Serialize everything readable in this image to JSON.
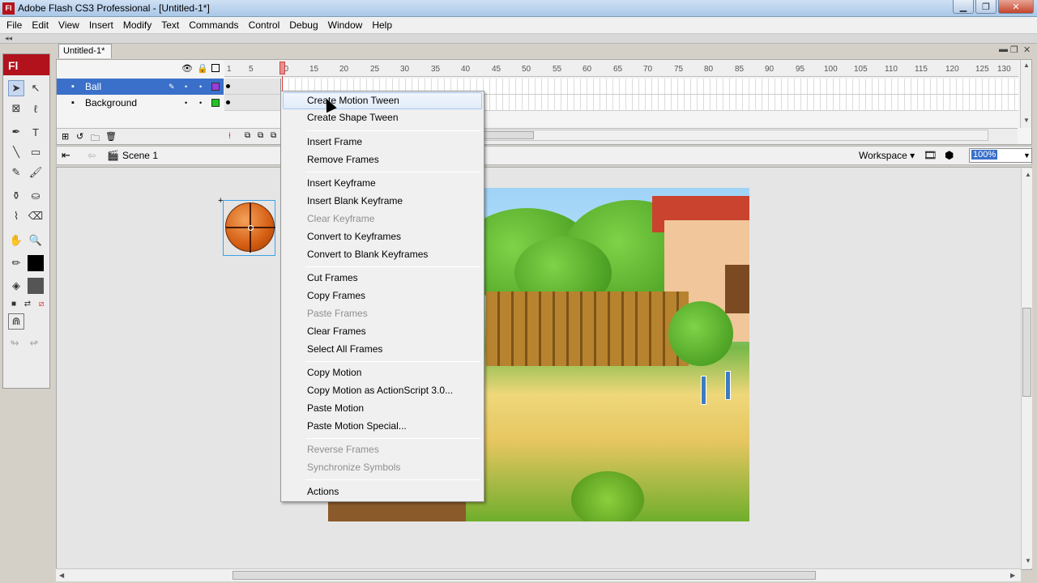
{
  "window": {
    "title": "Adobe Flash CS3 Professional - [Untitled-1*]",
    "logo": "Fl"
  },
  "menubar": {
    "items": [
      "File",
      "Edit",
      "View",
      "Insert",
      "Modify",
      "Text",
      "Commands",
      "Control",
      "Debug",
      "Window",
      "Help"
    ]
  },
  "toolbox": {
    "logo": "Fl"
  },
  "document": {
    "tab": "Untitled-1*"
  },
  "timeline": {
    "ruler": [
      "1",
      "5",
      "10",
      "15",
      "20",
      "25",
      "30",
      "35",
      "40",
      "45",
      "50",
      "55",
      "60",
      "65",
      "70",
      "75",
      "80",
      "85",
      "90",
      "95",
      "100",
      "105",
      "110",
      "115",
      "120",
      "125",
      "130"
    ],
    "layers": [
      {
        "name": "Ball",
        "selected": true,
        "color": "#9b3be0"
      },
      {
        "name": "Background",
        "selected": false,
        "color": "#22c222"
      }
    ]
  },
  "editbar": {
    "scene": "Scene 1",
    "workspace": "Workspace ▾",
    "zoom": "100%"
  },
  "context_menu": {
    "items": [
      {
        "label": "Create Motion Tween",
        "enabled": true,
        "hover": true
      },
      {
        "label": "Create Shape Tween",
        "enabled": true
      },
      {
        "label": "Insert Frame",
        "enabled": true
      },
      {
        "label": "Remove Frames",
        "enabled": true
      },
      {
        "label": "Insert Keyframe",
        "enabled": true
      },
      {
        "label": "Insert Blank Keyframe",
        "enabled": true
      },
      {
        "label": "Clear Keyframe",
        "enabled": false
      },
      {
        "label": "Convert to Keyframes",
        "enabled": true
      },
      {
        "label": "Convert to Blank Keyframes",
        "enabled": true
      },
      {
        "label": "Cut Frames",
        "enabled": true
      },
      {
        "label": "Copy Frames",
        "enabled": true
      },
      {
        "label": "Paste Frames",
        "enabled": false
      },
      {
        "label": "Clear Frames",
        "enabled": true
      },
      {
        "label": "Select All Frames",
        "enabled": true
      },
      {
        "label": "Copy Motion",
        "enabled": true
      },
      {
        "label": "Copy Motion as ActionScript 3.0...",
        "enabled": true
      },
      {
        "label": "Paste Motion",
        "enabled": true
      },
      {
        "label": "Paste Motion Special...",
        "enabled": true
      },
      {
        "label": "Reverse Frames",
        "enabled": false
      },
      {
        "label": "Synchronize Symbols",
        "enabled": false
      },
      {
        "label": "Actions",
        "enabled": true
      }
    ]
  }
}
